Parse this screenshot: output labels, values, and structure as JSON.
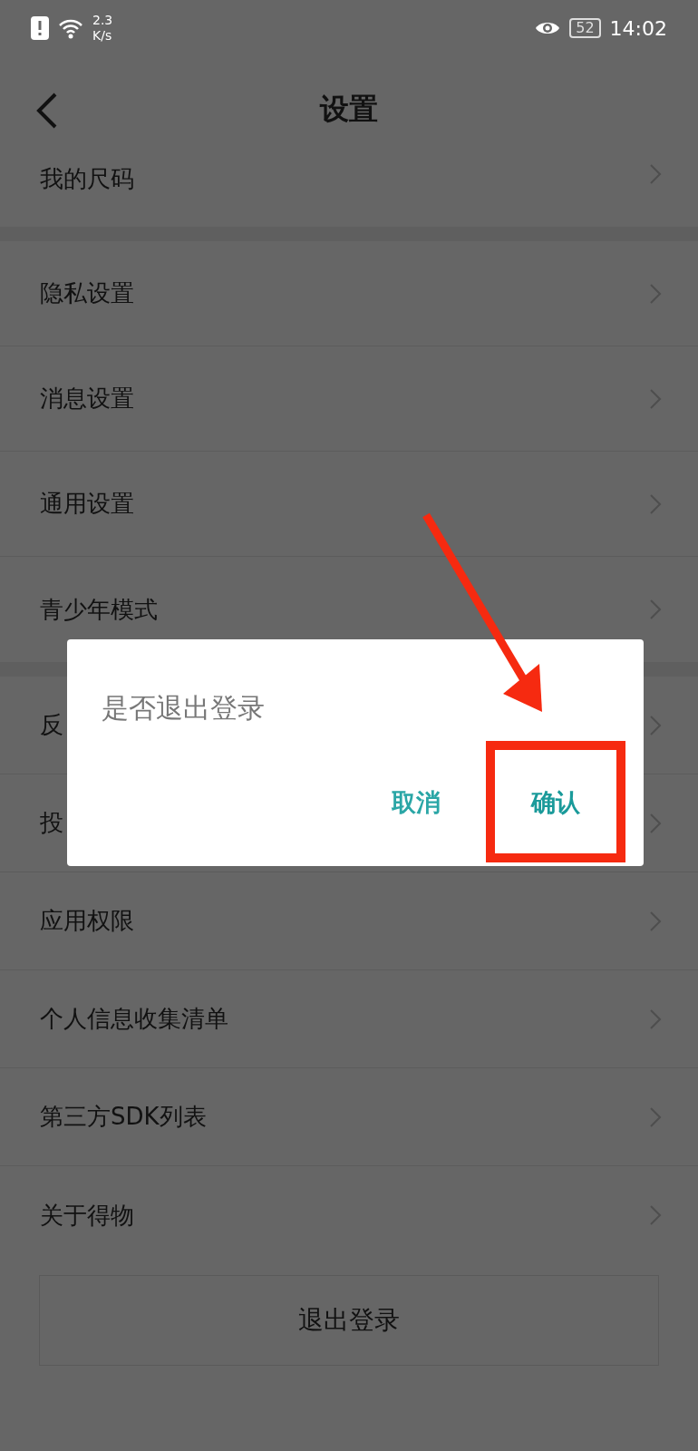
{
  "status_bar": {
    "speed_value": "2.3",
    "speed_unit": "K/s",
    "battery": "52",
    "time": "14:02"
  },
  "header": {
    "title": "设置"
  },
  "sections": [
    {
      "items": [
        {
          "label": "我的尺码"
        }
      ]
    },
    {
      "items": [
        {
          "label": "隐私设置"
        },
        {
          "label": "消息设置"
        },
        {
          "label": "通用设置"
        },
        {
          "label": "青少年模式"
        }
      ]
    },
    {
      "items": [
        {
          "label": "反"
        },
        {
          "label": "投"
        },
        {
          "label": "应用权限"
        },
        {
          "label": "个人信息收集清单"
        },
        {
          "label": "第三方SDK列表"
        },
        {
          "label": "关于得物"
        }
      ]
    }
  ],
  "logout_button": "退出登录",
  "dialog": {
    "message": "是否退出登录",
    "buttons": [
      {
        "label": "取消",
        "highlighted": false
      },
      {
        "label": "确认",
        "highlighted": true
      }
    ]
  }
}
